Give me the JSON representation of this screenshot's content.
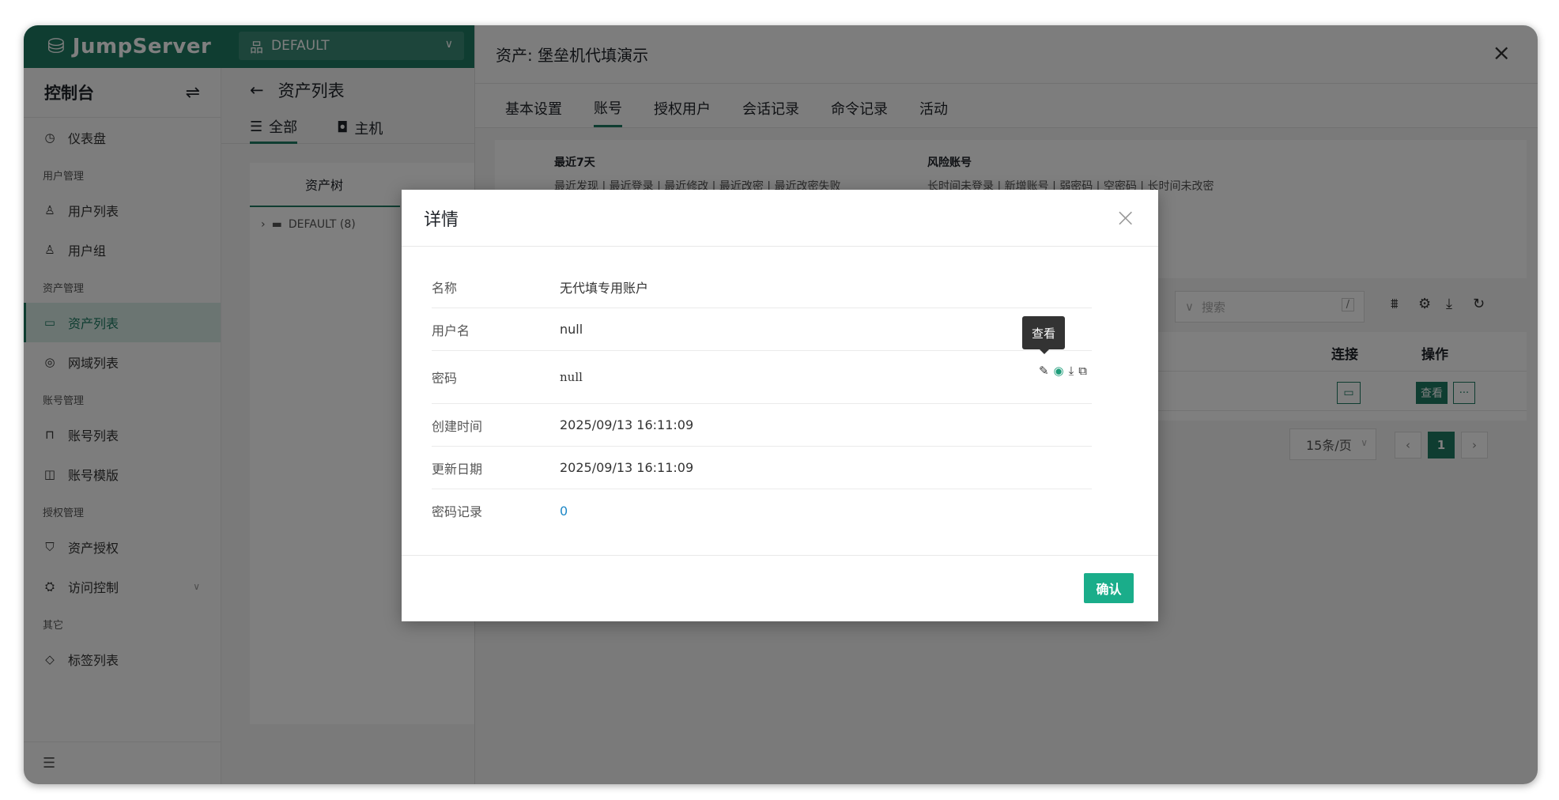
{
  "brand": {
    "name": "JumpServer"
  },
  "org": {
    "name": "DEFAULT"
  },
  "sidebar": {
    "title": "控制台",
    "items": [
      {
        "type": "item",
        "label": "仪表盘",
        "icon": "dashboard-icon",
        "glyph": "◷"
      },
      {
        "type": "group",
        "label": "用户管理"
      },
      {
        "type": "item",
        "label": "用户列表",
        "icon": "user-icon",
        "glyph": "♙"
      },
      {
        "type": "item",
        "label": "用户组",
        "icon": "user-group-icon",
        "glyph": "♙"
      },
      {
        "type": "group",
        "label": "资产管理"
      },
      {
        "type": "item",
        "label": "资产列表",
        "icon": "monitor-icon",
        "glyph": "▭",
        "active": true
      },
      {
        "type": "item",
        "label": "网域列表",
        "icon": "location-icon",
        "glyph": "◎"
      },
      {
        "type": "group",
        "label": "账号管理"
      },
      {
        "type": "item",
        "label": "账号列表",
        "icon": "lock-icon",
        "glyph": "⊓"
      },
      {
        "type": "item",
        "label": "账号模版",
        "icon": "template-icon",
        "glyph": "◫"
      },
      {
        "type": "group",
        "label": "授权管理"
      },
      {
        "type": "item",
        "label": "资产授权",
        "icon": "shield-icon",
        "glyph": "⛉"
      },
      {
        "type": "item",
        "label": "访问控制",
        "icon": "access-control-icon",
        "glyph": "⛭",
        "expandable": true
      },
      {
        "type": "group",
        "label": "其它"
      },
      {
        "type": "item",
        "label": "标签列表",
        "icon": "tag-icon",
        "glyph": "◇"
      }
    ]
  },
  "center": {
    "breadcrumb": "资产列表",
    "tabs": [
      "全部",
      "主机"
    ],
    "tree_header": "资产树",
    "tree_node": "DEFAULT (8)"
  },
  "drawer": {
    "title": "资产: 堡垒机代填演示",
    "tabs": [
      "基本设置",
      "账号",
      "授权用户",
      "会话记录",
      "命令记录",
      "活动"
    ],
    "stats": {
      "recent_title": "最近7天",
      "recent_links": "最近发现 | 最近登录 | 最近修改 | 最近改密 | 最近改密失败",
      "risk_title": "风险账号",
      "risk_links": "长时间未登录 | 新增账号 | 弱密码 | 空密码 | 长时间未改密"
    },
    "search_placeholder": "搜索",
    "search_shortcut": "/",
    "table": {
      "col_connect": "连接",
      "col_action": "操作",
      "view_label": "查看",
      "more_label": "···"
    },
    "pager": {
      "page_size": "15条/页",
      "current": "1"
    }
  },
  "modal": {
    "title": "详情",
    "rows": [
      {
        "key": "名称",
        "value": "无代填专用账户"
      },
      {
        "key": "用户名",
        "value": "null"
      },
      {
        "key": "密码",
        "value": "null"
      },
      {
        "key": "创建时间",
        "value": "2025/09/13 16:11:09"
      },
      {
        "key": "更新日期",
        "value": "2025/09/13 16:11:09"
      },
      {
        "key": "密码记录",
        "value": "0"
      }
    ],
    "tooltip": "查看",
    "confirm": "确认"
  }
}
